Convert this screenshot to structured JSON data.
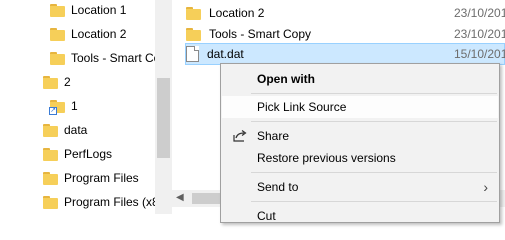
{
  "nav": {
    "items": [
      {
        "label": "Location 1",
        "icon": "folder-icon"
      },
      {
        "label": "Location 2",
        "icon": "folder-icon"
      },
      {
        "label": "Tools - Smart Co",
        "icon": "folder-icon"
      },
      {
        "label": "2",
        "icon": "folder-icon"
      },
      {
        "label": "1",
        "icon": "folder-shortcut-icon"
      },
      {
        "label": "data",
        "icon": "folder-icon"
      },
      {
        "label": "PerfLogs",
        "icon": "folder-icon"
      },
      {
        "label": "Program Files",
        "icon": "folder-icon"
      },
      {
        "label": "Program Files (x8",
        "icon": "folder-icon"
      }
    ]
  },
  "files": [
    {
      "name": "Location 2",
      "date": "23/10/201",
      "icon": "folder-icon"
    },
    {
      "name": "Tools - Smart Copy",
      "date": "23/10/201",
      "icon": "folder-icon"
    },
    {
      "name": "dat.dat",
      "date": "15/10/201",
      "icon": "file-icon",
      "selected": true
    }
  ],
  "context_menu": {
    "items": [
      {
        "label": "Open with",
        "bold": true
      },
      {
        "label": "Pick Link Source",
        "hover": true
      },
      {
        "label": "Share",
        "icon": "share-icon"
      },
      {
        "label": "Restore previous versions"
      },
      {
        "label": "Send to",
        "submenu": true
      },
      {
        "label": "Cut"
      }
    ]
  },
  "colors": {
    "selection": "#cce8ff",
    "selection_border": "#99d1ff",
    "folder": "#f6cf59",
    "menu_bg": "#f2f2f2"
  }
}
